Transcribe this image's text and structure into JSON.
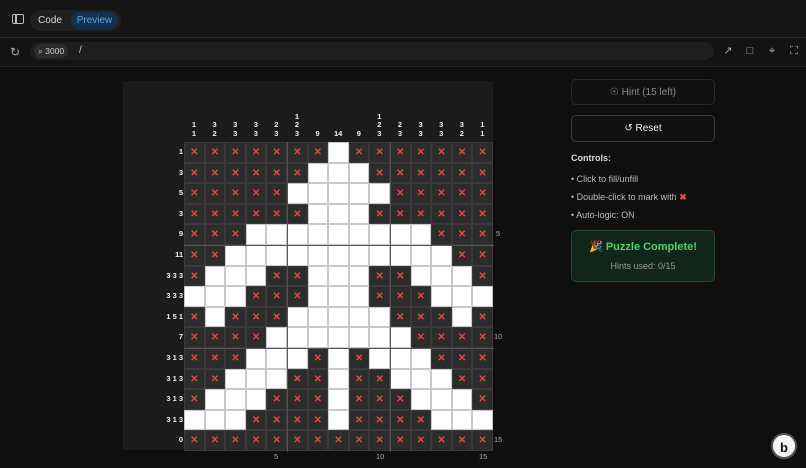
{
  "tabs": {
    "code": "Code",
    "preview": "Preview"
  },
  "url": {
    "port": "3000",
    "path": "/"
  },
  "icons": {
    "sidebar": "sidebar-toggle-icon",
    "reload": "reload-icon",
    "port": "port-icon",
    "open_external": "external-link-icon",
    "devices": "devices-icon",
    "inspect": "inspect-icon",
    "fullscreen": "fullscreen-icon",
    "hint": "lightbulb-icon",
    "reset": "reset-icon",
    "brand": "bolt-logo-icon"
  },
  "brand_badge": "b",
  "column_clues": [
    "1\n1",
    "3\n2",
    "3\n3",
    "3\n3",
    "2\n3",
    "1\n2\n3",
    "9",
    "14",
    "9",
    "1\n2\n3",
    "2\n3",
    "3\n3",
    "3\n3",
    "3\n2",
    "1\n1"
  ],
  "row_clues": [
    "1",
    "3",
    "5",
    "3",
    "9",
    "11",
    "3 3 3",
    "3 3 3",
    "1 5 1",
    "7",
    "3 1 3",
    "3 1 3",
    "3 1 3",
    "3 1 3",
    "0"
  ],
  "grid": [
    "XXXXXXX#XXXXXXX",
    "XXXXXX###XXXXXX",
    "XXXXX#####XXXXX",
    "XXXXXX###XXXXXX",
    "XXX#########XXX",
    "XX###########XX",
    "X###XX###XX###X",
    "###XXX###XXX###",
    "X#XXX#####XXX#X",
    "XXXX#######XXXX",
    "XXX###X#X###XXX",
    "XX###XX#XX###XX",
    "X###XXX#XXX###X",
    "###XXXX#XXXX###",
    "XXXXXXXXXXXXXXX"
  ],
  "ruler_marks": {
    "right": [
      "5",
      "10",
      "15"
    ],
    "bottom": [
      "5",
      "10",
      "15"
    ]
  },
  "panel": {
    "hint_label": "Hint (15 left)",
    "reset_label": "Reset",
    "controls_title": "Controls:",
    "controls": [
      "• Click to fill/unfill",
      "• Double-click to mark with",
      "• Auto-logic: ON"
    ],
    "complete_title": "🎉 Puzzle Complete!",
    "hints_used": "Hints used: 0/15"
  },
  "colors": {
    "accent": "#5aa6ea",
    "mark": "#e34a44",
    "success": "#4fd070"
  }
}
